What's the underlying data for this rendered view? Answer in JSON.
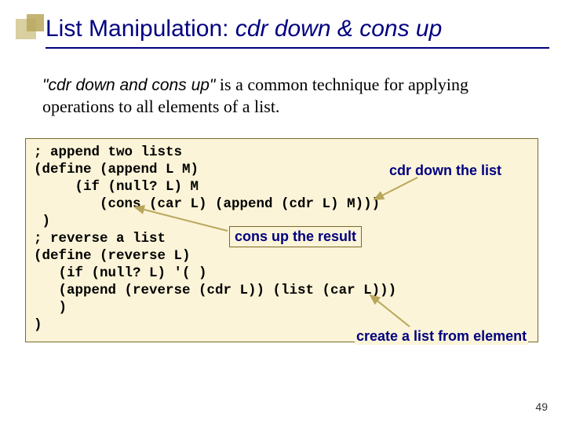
{
  "title": {
    "plain": "List Manipulation: ",
    "italic": "cdr down & cons up"
  },
  "paragraph": {
    "em": "\"cdr down and cons up\"",
    "rest": " is a common technique for applying operations to all elements of a list."
  },
  "code": "; append two lists\n(define (append L M)\n     (if (null? L) M\n        (cons (car L) (append (cdr L) M)))\n )\n; reverse a list\n(define (reverse L)\n   (if (null? L) '( )\n   (append (reverse (cdr L)) (list (car L)))\n   )\n)",
  "annotations": {
    "cdr_down": "cdr down the list",
    "cons_up": "cons up the result",
    "create_list": "create a list from element"
  },
  "page_number": "49"
}
